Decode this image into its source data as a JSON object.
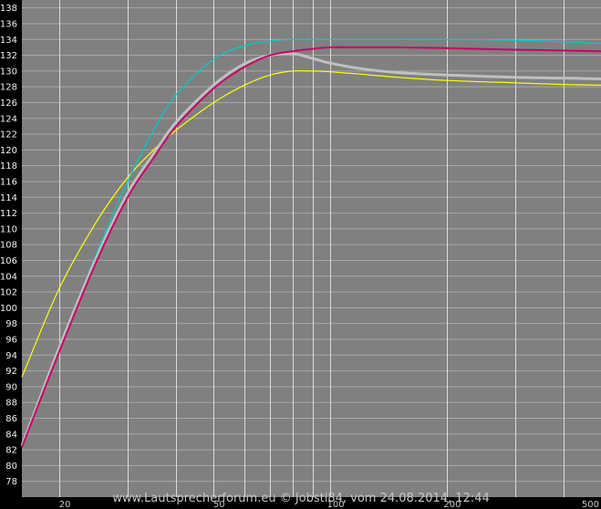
{
  "chart_data": {
    "type": "line",
    "title": "",
    "xlabel": "",
    "ylabel": "",
    "x_scale": "log",
    "xlim": [
      16,
      500
    ],
    "ylim": [
      76,
      139
    ],
    "yticks": [
      78,
      80,
      82,
      84,
      86,
      88,
      90,
      92,
      94,
      96,
      98,
      100,
      102,
      104,
      106,
      108,
      110,
      112,
      114,
      116,
      118,
      120,
      122,
      124,
      126,
      128,
      130,
      132,
      134,
      136,
      138
    ],
    "xtick_labels": [
      {
        "label": "20",
        "x": 20
      },
      {
        "label": "50",
        "x": 50
      },
      {
        "label": "100",
        "x": 100
      },
      {
        "label": "200",
        "x": 200
      },
      {
        "label": "500",
        "x": 500
      }
    ],
    "grid": true,
    "background": "#808080",
    "frame_color": "#000000",
    "credit": "www.Lautsprecherforum.eu © Jobsti84, vom 24.08.2014, 12:44",
    "series": [
      {
        "color": "#ffff00",
        "x": [
          16,
          20,
          25,
          30,
          35,
          40,
          50,
          60,
          70,
          80,
          90,
          100,
          120,
          150,
          200,
          300,
          400,
          500
        ],
        "y": [
          91.2,
          102.5,
          111,
          116.5,
          120,
          122.5,
          126,
          128.2,
          129.5,
          130,
          130,
          129.9,
          129.6,
          129.2,
          128.8,
          128.5,
          128.3,
          128.2
        ]
      },
      {
        "color": "#00cccc",
        "x": [
          16,
          20,
          25,
          30,
          35,
          40,
          50,
          60,
          70,
          80,
          90,
          100,
          120,
          150,
          200,
          300,
          400,
          500
        ],
        "y": [
          82.5,
          95,
          107,
          116,
          122.5,
          127,
          131.5,
          133.2,
          133.8,
          134,
          134,
          134,
          134,
          134,
          134,
          133.9,
          133.7,
          133.5
        ]
      },
      {
        "color": "#c0c0c0",
        "x": [
          16,
          20,
          25,
          30,
          35,
          40,
          50,
          60,
          70,
          80,
          90,
          100,
          120,
          150,
          200,
          300,
          400,
          500
        ],
        "y": [
          82.5,
          95,
          106.5,
          114.5,
          119.5,
          123.5,
          128.2,
          130.9,
          132,
          132.2,
          131.6,
          131,
          130.3,
          129.8,
          129.5,
          129.2,
          129.1,
          129
        ]
      },
      {
        "color": "#cc0066",
        "x": [
          16,
          20,
          25,
          30,
          35,
          40,
          50,
          60,
          70,
          80,
          90,
          100,
          120,
          150,
          200,
          300,
          400,
          500
        ],
        "y": [
          82.3,
          94.5,
          106,
          114,
          119,
          123,
          127.8,
          130.5,
          132,
          132.5,
          132.8,
          133,
          133,
          133,
          132.9,
          132.7,
          132.6,
          132.5
        ]
      }
    ]
  }
}
